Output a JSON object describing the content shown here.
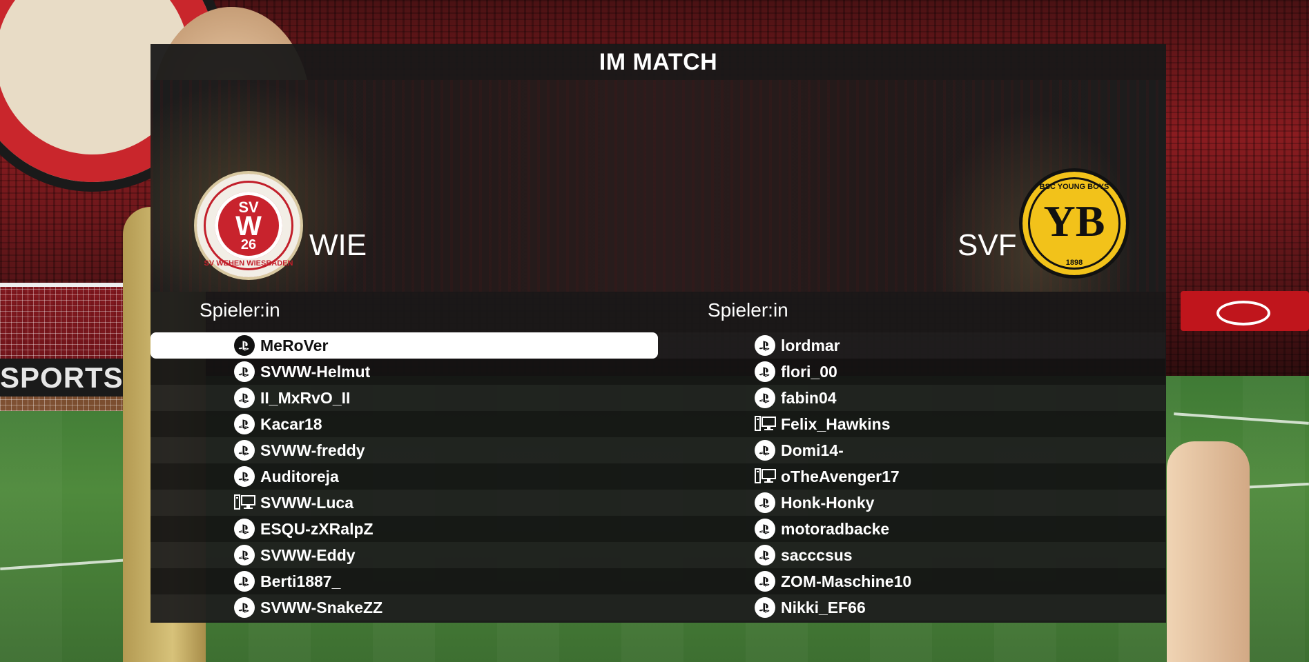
{
  "screen_title": "IM MATCH",
  "home_team": {
    "abbr": "WIE",
    "crest_top": "SV",
    "crest_num": "26",
    "crest_ring": "SV WEHEN WIESBADEN",
    "color": "#c8232d"
  },
  "away_team": {
    "abbr": "SVF",
    "crest_ring": "BSC YOUNG BOYS",
    "crest_letters": "YB",
    "crest_year": "1898",
    "color": "#f2c21a"
  },
  "column_header": "Spieler:in",
  "home_players": [
    {
      "name": "MeRoVer",
      "platform": "playstation-icon",
      "selected": true
    },
    {
      "name": "SVWW-Helmut",
      "platform": "playstation-icon"
    },
    {
      "name": "II_MxRvO_II",
      "platform": "playstation-icon"
    },
    {
      "name": "Kacar18",
      "platform": "playstation-icon"
    },
    {
      "name": "SVWW-freddy",
      "platform": "playstation-icon"
    },
    {
      "name": "Auditoreja",
      "platform": "playstation-icon"
    },
    {
      "name": "SVWW-Luca",
      "platform": "pc-icon"
    },
    {
      "name": "ESQU-zXRalpZ",
      "platform": "playstation-icon"
    },
    {
      "name": "SVWW-Eddy",
      "platform": "playstation-icon"
    },
    {
      "name": "Berti1887_",
      "platform": "playstation-icon"
    },
    {
      "name": "SVWW-SnakeZZ",
      "platform": "playstation-icon"
    }
  ],
  "away_players": [
    {
      "name": "lordmar",
      "platform": "playstation-icon"
    },
    {
      "name": "flori_00",
      "platform": "playstation-icon"
    },
    {
      "name": "fabin04",
      "platform": "playstation-icon"
    },
    {
      "name": "Felix_Hawkins",
      "platform": "pc-icon"
    },
    {
      "name": "Domi14-",
      "platform": "playstation-icon"
    },
    {
      "name": "oTheAvenger17",
      "platform": "pc-icon"
    },
    {
      "name": "Honk-Honky",
      "platform": "playstation-icon"
    },
    {
      "name": "motoradbacke",
      "platform": "playstation-icon"
    },
    {
      "name": "sacccsus",
      "platform": "playstation-icon"
    },
    {
      "name": "ZOM-Maschine10",
      "platform": "playstation-icon"
    },
    {
      "name": "Nikki_EF66",
      "platform": "playstation-icon"
    }
  ],
  "background": {
    "ad_board_text": "SPORTS"
  }
}
